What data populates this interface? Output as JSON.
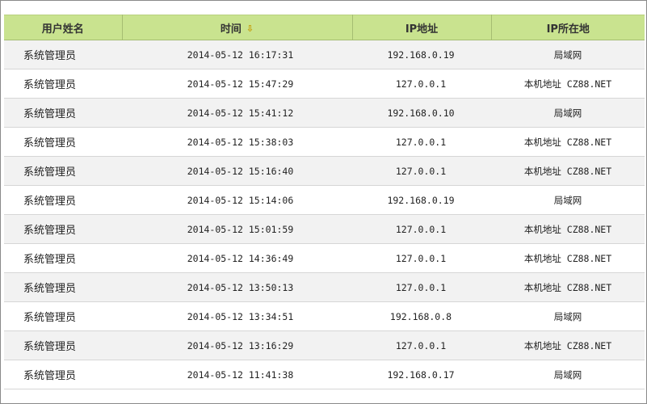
{
  "table": {
    "headers": {
      "user": "用户姓名",
      "time": "时间",
      "ip": "IP地址",
      "location": "IP所在地"
    },
    "sort_icon": "sort-down-arrow-icon",
    "rows": [
      {
        "user": "系统管理员",
        "time": "2014-05-12 16:17:31",
        "ip": "192.168.0.19",
        "location": "局域网"
      },
      {
        "user": "系统管理员",
        "time": "2014-05-12 15:47:29",
        "ip": "127.0.0.1",
        "location": "本机地址 CZ88.NET"
      },
      {
        "user": "系统管理员",
        "time": "2014-05-12 15:41:12",
        "ip": "192.168.0.10",
        "location": "局域网"
      },
      {
        "user": "系统管理员",
        "time": "2014-05-12 15:38:03",
        "ip": "127.0.0.1",
        "location": "本机地址 CZ88.NET"
      },
      {
        "user": "系统管理员",
        "time": "2014-05-12 15:16:40",
        "ip": "127.0.0.1",
        "location": "本机地址 CZ88.NET"
      },
      {
        "user": "系统管理员",
        "time": "2014-05-12 15:14:06",
        "ip": "192.168.0.19",
        "location": "局域网"
      },
      {
        "user": "系统管理员",
        "time": "2014-05-12 15:01:59",
        "ip": "127.0.0.1",
        "location": "本机地址 CZ88.NET"
      },
      {
        "user": "系统管理员",
        "time": "2014-05-12 14:36:49",
        "ip": "127.0.0.1",
        "location": "本机地址 CZ88.NET"
      },
      {
        "user": "系统管理员",
        "time": "2014-05-12 13:50:13",
        "ip": "127.0.0.1",
        "location": "本机地址 CZ88.NET"
      },
      {
        "user": "系统管理员",
        "time": "2014-05-12 13:34:51",
        "ip": "192.168.0.8",
        "location": "局域网"
      },
      {
        "user": "系统管理员",
        "time": "2014-05-12 13:16:29",
        "ip": "127.0.0.1",
        "location": "本机地址 CZ88.NET"
      },
      {
        "user": "系统管理员",
        "time": "2014-05-12 11:41:38",
        "ip": "192.168.0.17",
        "location": "局域网"
      }
    ]
  },
  "colors": {
    "header_bg": "#c9e38f",
    "row_alt_bg": "#f2f2f2",
    "sort_icon": "#c49a00"
  }
}
